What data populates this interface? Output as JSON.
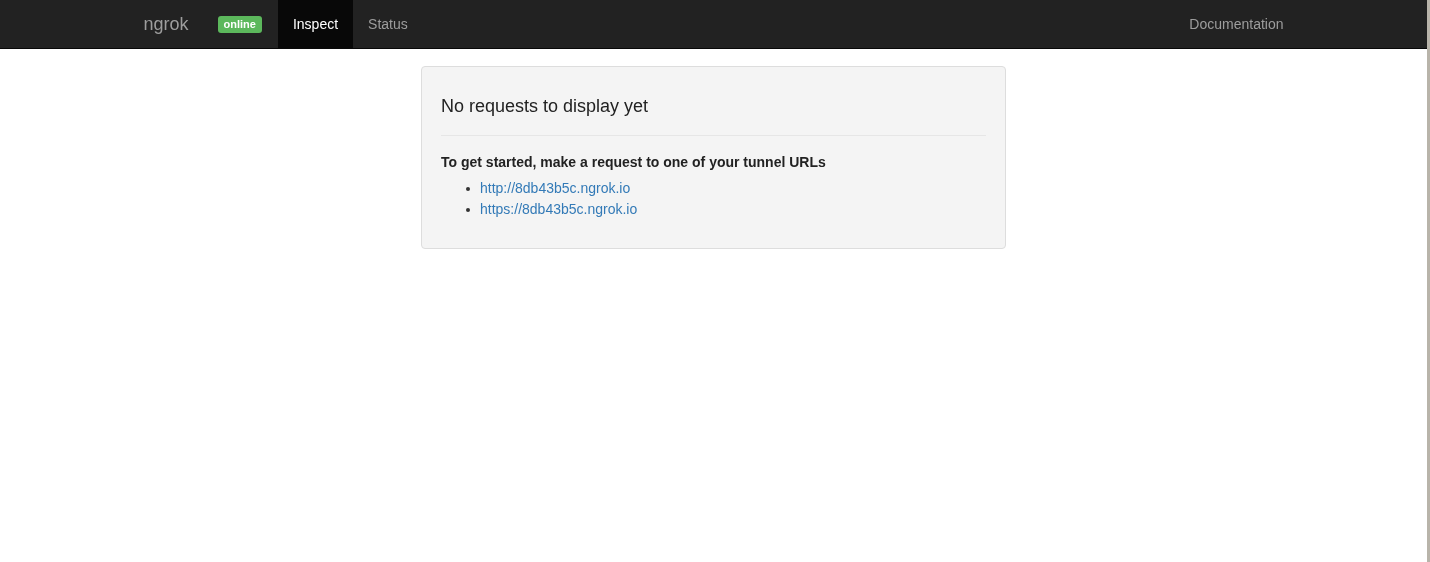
{
  "navbar": {
    "brand": "ngrok",
    "status_badge": "online",
    "tabs": [
      {
        "label": "Inspect",
        "selected": true
      },
      {
        "label": "Status",
        "selected": false
      }
    ],
    "right_link": "Documentation"
  },
  "panel": {
    "title": "No requests to display yet",
    "instruction": "To get started, make a request to one of your tunnel URLs",
    "urls": [
      "http://8db43b5c.ngrok.io",
      "https://8db43b5c.ngrok.io"
    ]
  }
}
